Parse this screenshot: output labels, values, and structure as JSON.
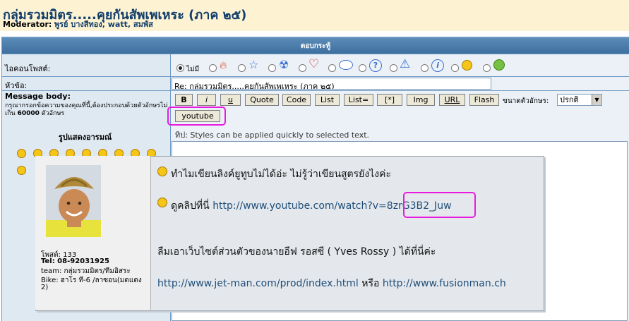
{
  "header": {
    "title": "กลุ่มรวมมิตร.....คุยกันสัพเพเหระ (ภาค ๒๕)",
    "moderator_label": "Moderator:",
    "moderators": "พูรย์ บางสีทอง, watt, สมพัส"
  },
  "form": {
    "table_header": "ตอบกระทู้",
    "icon_label": "ไอคอนโพสต์:",
    "icon_none_label": "ไม่มี",
    "subject_label": "หัวข้อ:",
    "subject_value": "Re: กลุ่มรวมมิตร.....คุยกันสัพเพเหระ (ภาค ๒๕)",
    "body_label": "Message body:",
    "body_hint": "กรุณากรอกข้อความของคุณที่นี้,ต้องประกอบด้วยตัวอักษรไม่เกิน",
    "body_hint_number": "60000",
    "body_hint_suffix": "ตัวอักษร",
    "smileys_label": "รูปแสดงอารมณ์",
    "buttons": {
      "bold": "B",
      "italic": "i",
      "underline": "u",
      "quote": "Quote",
      "code": "Code",
      "list": "List",
      "list_eq": "List=",
      "list_item": "[*]",
      "img": "Img",
      "url": "URL",
      "flash": "Flash",
      "youtube": "youtube"
    },
    "font_size_label": "ขนาดตัวอักษร:",
    "font_size_value": "ปรกติ",
    "tip": "ทิป: Styles can be applied quickly to selected text."
  },
  "popup": {
    "posts": "โพสต์: 133",
    "tel": "Tel: 08-92031925",
    "team": "team: กลุ่มรวมมิตร/ทีมอิสระ",
    "bike_line1": "Bike: ฮาโร ที-6 /ลาซอน(มดแดง",
    "bike_line2": "2)",
    "line1": "ทำไมเขียนลิงค์ยูทูบไม่ได้อ่ะ ไม่รู้ว่าเขียนสูตรยังไงค่ะ",
    "line2_prefix": "ดูคลิปที่นี่",
    "line2_url_main": "http://www.youtube.com/watch?v=",
    "line2_url_id": "8zrG3B2_Juw",
    "line3": "ลืมเอาเว็บไซต์ส่วนตัวของนายอีฟ รอสซี ( Yves Rossy ) ได้ที่นี่ค่ะ",
    "line4_url1": "http://www.jet-man.com/prod/index.html",
    "line4_or": "หรือ",
    "line4_url2": "http://www.fusionman.ch"
  },
  "colors": {
    "title": "#123e6b",
    "header_bg": "#fdf3d3",
    "table_header": "#3d6f9f",
    "highlight": "#e91ae0",
    "link": "#1f4e7a"
  },
  "icons": [
    "none-radio",
    "flame-icon",
    "star-icon",
    "radioactive-icon",
    "heart-icon",
    "thought-bubble-icon",
    "question-icon",
    "warning-icon",
    "info-icon",
    "wink-icon",
    "laugh-icon"
  ]
}
